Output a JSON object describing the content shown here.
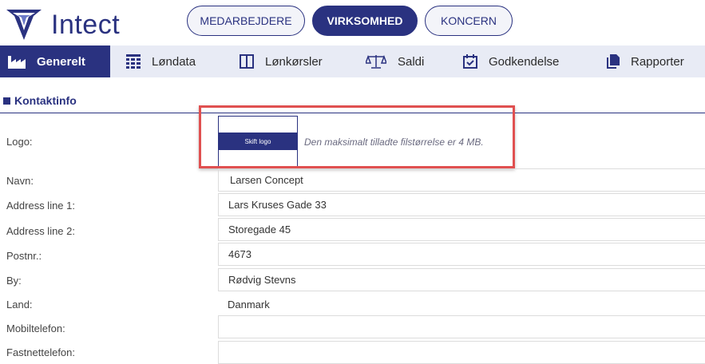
{
  "brand": {
    "name": "Intect"
  },
  "scope_tabs": [
    {
      "label": "MEDARBEJDERE"
    },
    {
      "label": "VIRKSOMHED"
    },
    {
      "label": "KONCERN"
    }
  ],
  "nav": [
    {
      "label": "Generelt",
      "icon": "factory-icon"
    },
    {
      "label": "Løndata",
      "icon": "grid-icon"
    },
    {
      "label": "Lønkørsler",
      "icon": "columns-icon"
    },
    {
      "label": "Saldi",
      "icon": "scale-icon"
    },
    {
      "label": "Godkendelse",
      "icon": "calendar-check-icon"
    },
    {
      "label": "Rapporter",
      "icon": "documents-icon"
    }
  ],
  "section": {
    "title": "Kontaktinfo"
  },
  "form": {
    "logo": {
      "label": "Logo:",
      "button": "Skift logo",
      "hint": "Den maksimalt tilladte filstørrelse er 4 MB."
    },
    "navn": {
      "label": "Navn:",
      "value": "Larsen Concept"
    },
    "address1": {
      "label": "Address line 1:",
      "value": "Lars Kruses Gade 33"
    },
    "address2": {
      "label": "Address line 2:",
      "value": "Storegade 45"
    },
    "postnr": {
      "label": "Postnr.:",
      "value": "4673"
    },
    "by": {
      "label": "By:",
      "value": "Rødvig Stevns"
    },
    "land": {
      "label": "Land:",
      "value": "Danmark"
    },
    "mobil": {
      "label": "Mobiltelefon:",
      "value": ""
    },
    "fastnet": {
      "label": "Fastnettelefon:",
      "value": ""
    }
  },
  "colors": {
    "primary": "#2a3280",
    "nav_bg": "#e8ebf5",
    "highlight": "#e05050"
  }
}
